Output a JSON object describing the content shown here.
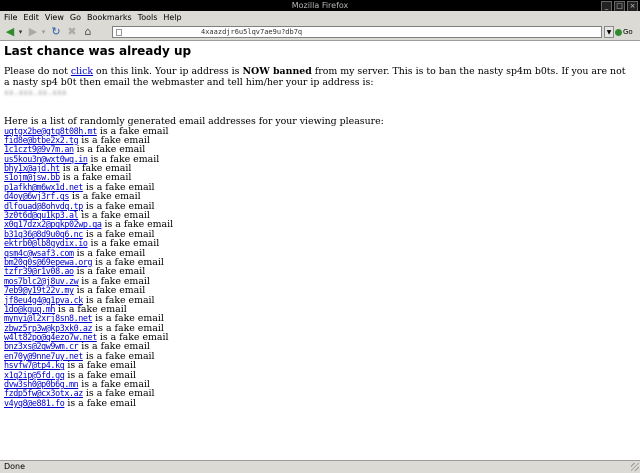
{
  "window": {
    "title": "Mozilla Firefox"
  },
  "menu": [
    "File",
    "Edit",
    "View",
    "Go",
    "Bookmarks",
    "Tools",
    "Help"
  ],
  "toolbar": {
    "url": "4xaazdjr6u5lqv7ae9u?db7q",
    "go_label": "Go"
  },
  "page": {
    "heading": "Last chance was already up",
    "text_before_link": "Please do not ",
    "link_text": "click",
    "text_after_link": " on this link. Your ip address is ",
    "now_banned": "NOW banned",
    "text_after_banned": " from my server. This is to ban the nasty sp4m b0ts. If you are not a nasty sp4 b0t then email the webmaster and tell him/her your ip address is:",
    "ip_address": "xx.xxx.xx.xxx",
    "intro": "Here is a list of randomly generated email addresses for your viewing pleasure:",
    "suffix": " is a fake email",
    "emails": [
      "uqtgx2be@qtq8t08h.mt",
      "fid8e@btbe2x2.tg",
      "1c1czt9@9v7m.an",
      "us5kou3n@wxt0wq.in",
      "bhy1x@ajd.ht",
      "s1ojm@jsw.bb",
      "p1afkh@m6wx1d.net",
      "d4oy@6wj3rf.gs",
      "dlfouad@8ohvdq.tp",
      "3z0t6d@qu1kp3.al",
      "x0g17dzx2@pgkp02wp.ga",
      "b31q36@8d9u0q6.nc",
      "ektrb0@lb8gydix.io",
      "qsm4c@wsaf3.com",
      "bm20q0s@69epewa.org",
      "tzfr39@r1v08.ao",
      "mos7blc2@j8uv.zw",
      "7eb9@y19t22v.my",
      "jf8eu4g4@q1pva.ck",
      "1do@kguq.mh",
      "mynyi@l2xrj8sn8.net",
      "zbwz5rp3w@kp3xk0.az",
      "w4lt82po@q4ezo7w.net",
      "bnz3xs@2gw9wm.cr",
      "en70y@9nne7uy.net",
      "hsvfw7@tp4.kg",
      "x1q2ip@5fd.gq",
      "dvw3sh0@p0b6g.mn",
      "fzdp5fw@cx3otx.az",
      "v4yq8@e881.fo"
    ]
  },
  "statusbar": {
    "text": "Done"
  },
  "icons": {
    "back": "back-arrow-icon",
    "forward": "forward-arrow-icon",
    "reload": "reload-icon",
    "stop": "stop-icon",
    "home": "home-icon",
    "page": "page-icon",
    "go": "go-icon"
  },
  "colors": {
    "link": "#0000cc",
    "chrome": "#dcdad5",
    "titlebar": "#000000"
  }
}
